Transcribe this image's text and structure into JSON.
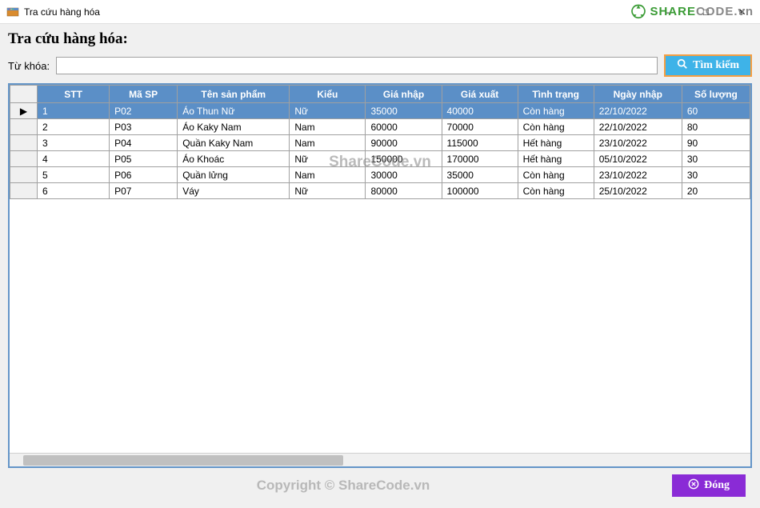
{
  "window": {
    "title": "Tra cứu hàng hóa",
    "minimize": "—",
    "maximize": "□",
    "close": "✕"
  },
  "brand": {
    "green": "SHARE",
    "gray": "CODE.vn"
  },
  "page": {
    "title": "Tra cứu hàng hóa:"
  },
  "search": {
    "label": "Từ khóa:",
    "value": "",
    "button": "Tìm kiếm"
  },
  "table": {
    "columns": [
      "STT",
      "Mã SP",
      "Tên sản phẩm",
      "Kiểu",
      "Giá nhập",
      "Giá xuất",
      "Tình trạng",
      "Ngày nhập",
      "Số lượng"
    ],
    "rows": [
      {
        "selected": true,
        "indicator": "▶",
        "cells": [
          "1",
          "P02",
          "Áo Thun Nữ",
          "Nữ",
          "35000",
          "40000",
          "Còn hàng",
          "22/10/2022",
          "60"
        ]
      },
      {
        "selected": false,
        "indicator": "",
        "cells": [
          "2",
          "P03",
          "Áo Kaky Nam",
          "Nam",
          "60000",
          "70000",
          "Còn hàng",
          "22/10/2022",
          "80"
        ]
      },
      {
        "selected": false,
        "indicator": "",
        "cells": [
          "3",
          "P04",
          "Quần Kaky Nam",
          "Nam",
          "90000",
          "115000",
          "Hết hàng",
          "23/10/2022",
          "90"
        ]
      },
      {
        "selected": false,
        "indicator": "",
        "cells": [
          "4",
          "P05",
          "Áo Khoác",
          "Nữ",
          "150000",
          "170000",
          "Hết hàng",
          "05/10/2022",
          "30"
        ]
      },
      {
        "selected": false,
        "indicator": "",
        "cells": [
          "5",
          "P06",
          "Quần lửng",
          "Nam",
          "30000",
          "35000",
          "Còn hàng",
          "23/10/2022",
          "30"
        ]
      },
      {
        "selected": false,
        "indicator": "",
        "cells": [
          "6",
          "P07",
          "Váy",
          "Nữ",
          "80000",
          "100000",
          "Còn hàng",
          "25/10/2022",
          "20"
        ]
      }
    ]
  },
  "footer": {
    "copyright": "Copyright © ShareCode.vn",
    "close_label": "Đóng"
  },
  "watermark": "ShareCode.vn"
}
